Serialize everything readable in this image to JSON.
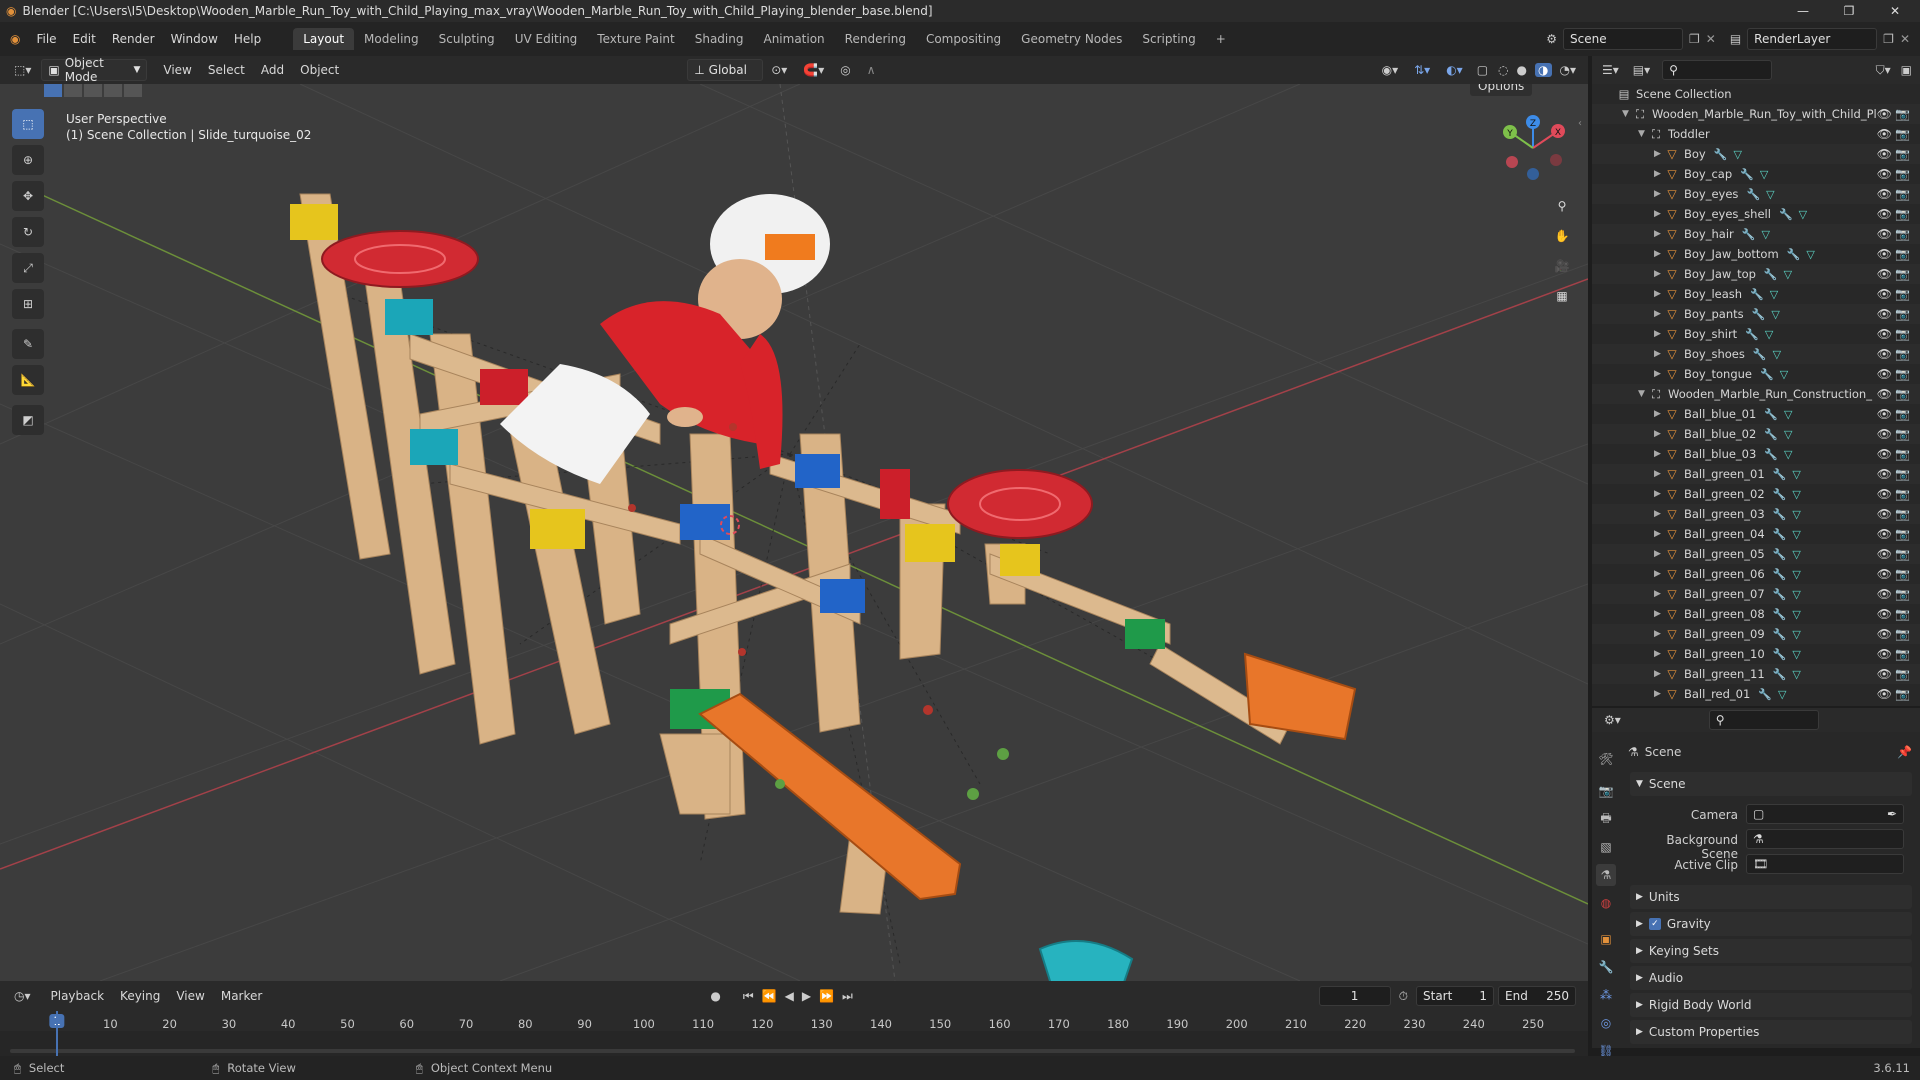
{
  "window": {
    "title": "Blender [C:\\Users\\I5\\Desktop\\Wooden_Marble_Run_Toy_with_Child_Playing_max_vray\\Wooden_Marble_Run_Toy_with_Child_Playing_blender_base.blend]",
    "controls": [
      "—",
      "❐",
      "✕"
    ]
  },
  "menus": [
    "File",
    "Edit",
    "Render",
    "Window",
    "Help"
  ],
  "workspaces": [
    "Layout",
    "Modeling",
    "Sculpting",
    "UV Editing",
    "Texture Paint",
    "Shading",
    "Animation",
    "Rendering",
    "Compositing",
    "Geometry Nodes",
    "Scripting"
  ],
  "active_workspace": "Layout",
  "scene_field": "Scene",
  "render_layer_field": "RenderLayer",
  "viewport_header": {
    "mode": "Object Mode",
    "menus": [
      "View",
      "Select",
      "Add",
      "Object"
    ],
    "transform_orientation": "Global",
    "options_label": "Options"
  },
  "viewport": {
    "perspective_label": "User Perspective",
    "collection_label": "(1) Scene Collection | Slide_turquoise_02",
    "gizmo": {
      "z": "Z",
      "y": "Y",
      "x": "X"
    }
  },
  "outliner": {
    "root": "Scene Collection",
    "rows": [
      {
        "level": 1,
        "kind": "collection",
        "expanded": true,
        "label": "Wooden_Marble_Run_Toy_with_Child_Pl"
      },
      {
        "level": 2,
        "kind": "collection",
        "expanded": true,
        "label": "Toddler"
      },
      {
        "level": 3,
        "kind": "object",
        "label": "Boy"
      },
      {
        "level": 3,
        "kind": "object",
        "label": "Boy_cap"
      },
      {
        "level": 3,
        "kind": "object",
        "label": "Boy_eyes"
      },
      {
        "level": 3,
        "kind": "object",
        "label": "Boy_eyes_shell"
      },
      {
        "level": 3,
        "kind": "object",
        "label": "Boy_hair"
      },
      {
        "level": 3,
        "kind": "object",
        "label": "Boy_Jaw_bottom"
      },
      {
        "level": 3,
        "kind": "object",
        "label": "Boy_Jaw_top"
      },
      {
        "level": 3,
        "kind": "object",
        "label": "Boy_leash"
      },
      {
        "level": 3,
        "kind": "object",
        "label": "Boy_pants"
      },
      {
        "level": 3,
        "kind": "object",
        "label": "Boy_shirt"
      },
      {
        "level": 3,
        "kind": "object",
        "label": "Boy_shoes"
      },
      {
        "level": 3,
        "kind": "object",
        "label": "Boy_tongue"
      },
      {
        "level": 2,
        "kind": "collection",
        "expanded": true,
        "label": "Wooden_Marble_Run_Construction_"
      },
      {
        "level": 3,
        "kind": "object",
        "label": "Ball_blue_01"
      },
      {
        "level": 3,
        "kind": "object",
        "label": "Ball_blue_02"
      },
      {
        "level": 3,
        "kind": "object",
        "label": "Ball_blue_03"
      },
      {
        "level": 3,
        "kind": "object",
        "label": "Ball_green_01"
      },
      {
        "level": 3,
        "kind": "object",
        "label": "Ball_green_02"
      },
      {
        "level": 3,
        "kind": "object",
        "label": "Ball_green_03"
      },
      {
        "level": 3,
        "kind": "object",
        "label": "Ball_green_04"
      },
      {
        "level": 3,
        "kind": "object",
        "label": "Ball_green_05"
      },
      {
        "level": 3,
        "kind": "object",
        "label": "Ball_green_06"
      },
      {
        "level": 3,
        "kind": "object",
        "label": "Ball_green_07"
      },
      {
        "level": 3,
        "kind": "object",
        "label": "Ball_green_08"
      },
      {
        "level": 3,
        "kind": "object",
        "label": "Ball_green_09"
      },
      {
        "level": 3,
        "kind": "object",
        "label": "Ball_green_10"
      },
      {
        "level": 3,
        "kind": "object",
        "label": "Ball_green_11"
      },
      {
        "level": 3,
        "kind": "object",
        "label": "Ball_red_01"
      }
    ]
  },
  "properties": {
    "breadcrumb": "Scene",
    "panel_title": "Scene",
    "fields": [
      {
        "label": "Camera",
        "value": ""
      },
      {
        "label": "Background Scene",
        "value": ""
      },
      {
        "label": "Active Clip",
        "value": ""
      }
    ],
    "sections": [
      {
        "label": "Units",
        "checkbox": false
      },
      {
        "label": "Gravity",
        "checkbox": true,
        "checked": true
      },
      {
        "label": "Keying Sets",
        "checkbox": false
      },
      {
        "label": "Audio",
        "checkbox": false
      },
      {
        "label": "Rigid Body World",
        "checkbox": false
      },
      {
        "label": "Custom Properties",
        "checkbox": false
      }
    ]
  },
  "timeline": {
    "menus": [
      "Playback",
      "Keying",
      "View",
      "Marker"
    ],
    "current_frame": "1",
    "start_label": "Start",
    "start": "1",
    "end_label": "End",
    "end": "250",
    "ticks": [
      "1",
      "10",
      "20",
      "30",
      "40",
      "50",
      "60",
      "70",
      "80",
      "90",
      "100",
      "110",
      "120",
      "130",
      "140",
      "150",
      "160",
      "170",
      "180",
      "190",
      "200",
      "210",
      "220",
      "230",
      "240",
      "250"
    ]
  },
  "statusbar": {
    "items": [
      "Select",
      "Rotate View",
      "Object Context Menu"
    ],
    "version": "3.6.11"
  },
  "colors": {
    "accent": "#4772b3",
    "object_icon": "#e2913b",
    "mesh_icon": "#5bd3c4",
    "axis_x": "#e04a5a",
    "axis_y": "#7ec04a",
    "axis_z": "#3d8ce8"
  }
}
